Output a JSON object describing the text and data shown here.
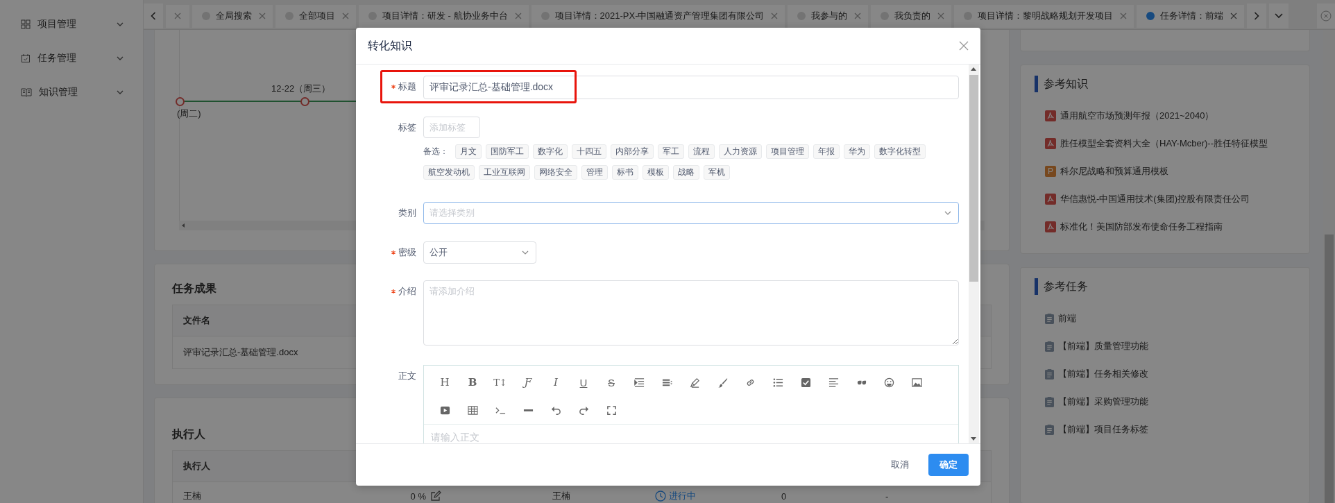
{
  "sidebar": {
    "items": [
      {
        "kind": "grid",
        "label": "项目管理",
        "expanded": false
      },
      {
        "kind": "calendar",
        "label": "任务管理",
        "expanded": false
      },
      {
        "kind": "book",
        "label": "知识管理",
        "expanded": false
      }
    ]
  },
  "tabs": [
    {
      "selected": false
    },
    {
      "label": "全局搜索",
      "selected": false
    },
    {
      "label": "全部项目",
      "selected": false
    },
    {
      "label": "项目详情：研发 - 航协业务中台",
      "selected": false
    },
    {
      "label": "项目详情：2021-PX-中国融通资产管理集团有限公司",
      "selected": false
    },
    {
      "label": "我参与的",
      "selected": false
    },
    {
      "label": "我负责的",
      "selected": false
    },
    {
      "label": "项目详情：黎明战略规划开发项目",
      "selected": false
    },
    {
      "label": "任务详情：前端",
      "selected": true
    }
  ],
  "timeline": {
    "points": [
      {
        "label": "(周二)"
      },
      {
        "label": "12-22（周三）"
      }
    ]
  },
  "results": {
    "title": "任务成果",
    "columns": [
      "文件名"
    ],
    "rows": [
      [
        "评审记录汇总-基础管理.docx"
      ]
    ]
  },
  "executors": {
    "title": "执行人",
    "columns": [
      "执行人"
    ],
    "rows": [
      {
        "name": "王楠",
        "progress": "0 %",
        "owner": "王楠",
        "status": "进行中",
        "count": "0",
        "column_6": "-"
      }
    ]
  },
  "reference_knowledge": {
    "title": "参考知识",
    "items": [
      {
        "kind": "pdf",
        "title": "通用航空市场预测年报（2021~2040）"
      },
      {
        "kind": "pdf",
        "title": "胜任模型全套资料大全（HAY-Mcber)--胜任特征模型"
      },
      {
        "kind": "ppt",
        "badge": "P",
        "title": "科尔尼战略和预算通用模板"
      },
      {
        "kind": "pdf",
        "title": "华信惠悦-中国通用技术(集团)控股有限责任公司"
      },
      {
        "kind": "pdf",
        "title": "标准化！美国防部发布使命任务工程指南"
      }
    ]
  },
  "reference_tasks": {
    "title": "参考任务",
    "items": [
      "前端",
      "【前端】质量管理功能",
      "【前端】任务相关修改",
      "【前端】采购管理功能",
      "【前端】项目任务标签"
    ]
  },
  "modal": {
    "title": "转化知识",
    "title_field": {
      "label": "标题",
      "required": true,
      "highlighted": true,
      "value": "评审记录汇总-基础管理.docx"
    },
    "tags_field": {
      "label": "标签",
      "placeholder": "添加标签",
      "suggestions_label": "备选：",
      "suggestions": [
        "月文",
        "国防军工",
        "数字化",
        "十四五",
        "内部分享",
        "军工",
        "流程",
        "人力资源",
        "项目管理",
        "年报",
        "华为",
        "数字化转型",
        "航空发动机",
        "工业互联网",
        "网络安全",
        "管理",
        "标书",
        "模板",
        "战略",
        "军机"
      ]
    },
    "category_field": {
      "label": "类别",
      "required": false,
      "focused": true,
      "placeholder": "请选择类别"
    },
    "security_field": {
      "label": "密级",
      "required": true,
      "value": "公开"
    },
    "intro_field": {
      "label": "介绍",
      "required": true,
      "placeholder": "请添加介绍"
    },
    "body_field": {
      "label": "正文",
      "placeholder": "请输入正文",
      "toolbar": [
        {
          "kind": "heading",
          "text": "H"
        },
        {
          "kind": "bold",
          "text": "B"
        },
        {
          "kind": "size",
          "text": "T↕"
        },
        {
          "kind": "font",
          "text": "Ƒ"
        },
        {
          "kind": "italic",
          "text": "I"
        },
        {
          "kind": "underline",
          "text": "U"
        },
        {
          "kind": "strike",
          "text": "S"
        },
        {
          "kind": "indent"
        },
        {
          "kind": "align"
        },
        {
          "kind": "pen"
        },
        {
          "kind": "brush"
        },
        {
          "kind": "link"
        },
        {
          "kind": "list"
        },
        {
          "kind": "checkbox"
        },
        {
          "kind": "paragraph"
        },
        {
          "kind": "quote"
        },
        {
          "kind": "emoji"
        },
        {
          "kind": "image"
        },
        {
          "kind": "video"
        },
        {
          "kind": "table"
        },
        {
          "kind": "code"
        },
        {
          "kind": "rule"
        },
        {
          "kind": "undo"
        },
        {
          "kind": "redo"
        },
        {
          "kind": "fullscreen"
        }
      ]
    },
    "buttons": [
      {
        "kind": "text",
        "label": "取消"
      },
      {
        "kind": "primary",
        "label": "确定"
      }
    ]
  }
}
